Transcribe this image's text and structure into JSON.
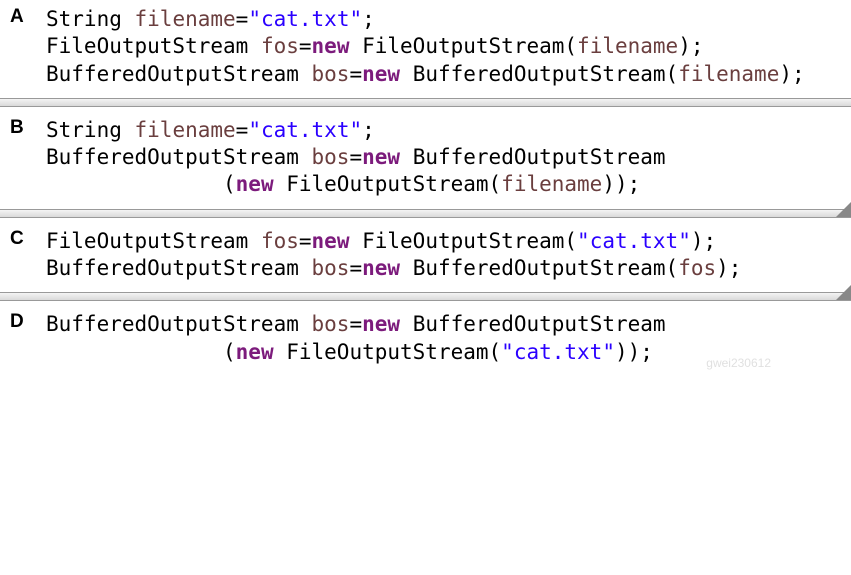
{
  "options": {
    "A": {
      "label": "A",
      "line1": {
        "t1": "String ",
        "v1": "filename",
        "t2": "=",
        "s1": "\"cat.txt\"",
        "t3": ";"
      },
      "line2": {
        "t1": "FileOutputStream ",
        "v1": "fos",
        "t2": "=",
        "k1": "new",
        "t3": " FileOutputStream(",
        "v2": "filename",
        "t4": ");"
      },
      "line3": {
        "t1": "BufferedOutputStream ",
        "v1": "bos",
        "t2": "=",
        "k1": "new",
        "t3": " BufferedOutputStream(",
        "v2": "filename",
        "t4": ");"
      }
    },
    "B": {
      "label": "B",
      "line1": {
        "t1": "String ",
        "v1": "filename",
        "t2": "=",
        "s1": "\"cat.txt\"",
        "t3": ";"
      },
      "line2": {
        "t1": "BufferedOutputStream ",
        "v1": "bos",
        "t2": "=",
        "k1": "new",
        "t3": " BufferedOutputStream"
      },
      "line3": {
        "t1": "              (",
        "k1": "new",
        "t2": " FileOutputStream(",
        "v1": "filename",
        "t3": "));"
      }
    },
    "C": {
      "label": "C",
      "line1": {
        "t1": "FileOutputStream ",
        "v1": "fos",
        "t2": "=",
        "k1": "new",
        "t3": " FileOutputStream(",
        "s1": "\"cat.txt\"",
        "t4": ");"
      },
      "line2": {
        "t1": "BufferedOutputStream ",
        "v1": "bos",
        "t2": "=",
        "k1": "new",
        "t3": " BufferedOutputStream(",
        "v2": "fos",
        "t4": ");"
      }
    },
    "D": {
      "label": "D",
      "line1": {
        "t1": "BufferedOutputStream ",
        "v1": "bos",
        "t2": "=",
        "k1": "new",
        "t3": " BufferedOutputStream"
      },
      "line2": {
        "t1": "              (",
        "k1": "new",
        "t2": " FileOutputStream(",
        "s1": "\"cat.txt\"",
        "t3": "));"
      }
    }
  },
  "watermark": "gwei230612"
}
